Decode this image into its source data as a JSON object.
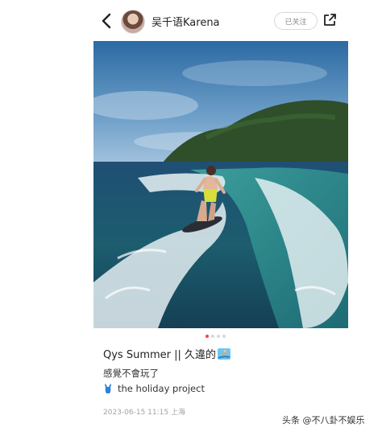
{
  "header": {
    "username": "吴千语Karena",
    "follow_label": "已关注"
  },
  "post": {
    "title": "Qys Summer || 久違的",
    "line1": "感覺不會玩了",
    "line2": "the holiday project",
    "meta": "2023-06-15 11:15 上海",
    "carousel": {
      "total": 4,
      "active": 1
    }
  },
  "watermark": "头条 @不八卦不娱乐",
  "icons": {
    "back": "back-chevron-icon",
    "share": "share-out-icon",
    "surf": "surfer-emoji-icon",
    "swim": "swimsuit-emoji-icon"
  },
  "colors": {
    "accent_dot": "#ff3b4a",
    "follow_border": "#d8d8d8",
    "meta_text": "#a3a3a3"
  }
}
